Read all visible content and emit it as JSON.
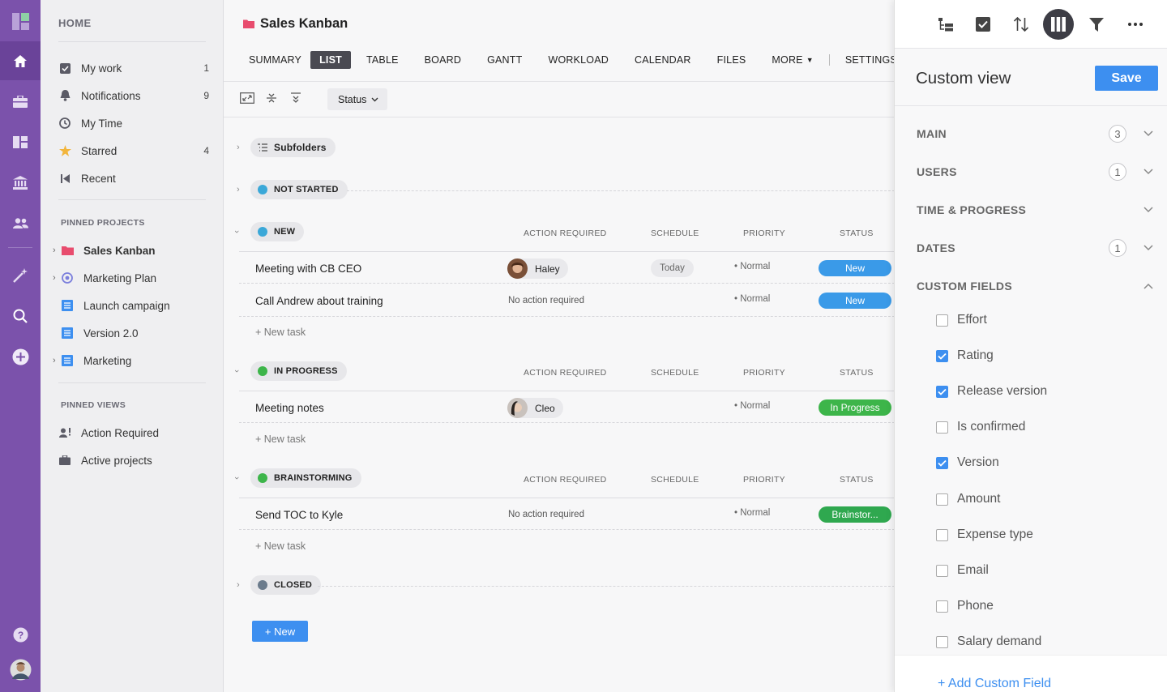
{
  "colors": {
    "accent": "#7b52ab",
    "primary": "#3d8ff0",
    "status_new": "#3a9ae8",
    "status_progress": "#3db54a",
    "status_brainstorm": "#2fa84f"
  },
  "rail": {
    "icons": [
      "app-logo-icon",
      "home-icon",
      "briefcase-icon",
      "dashboard-icon",
      "bank-icon",
      "people-icon",
      "magic-wand-icon",
      "search-icon",
      "add-icon",
      "help-icon",
      "user-avatar"
    ]
  },
  "sidebar": {
    "home_label": "HOME",
    "items": [
      {
        "label": "My work",
        "count": "1",
        "icon": "checkbox-icon"
      },
      {
        "label": "Notifications",
        "count": "9",
        "icon": "bell-icon"
      },
      {
        "label": "My Time",
        "count": "",
        "icon": "clock-icon"
      },
      {
        "label": "Starred",
        "count": "4",
        "icon": "star-icon"
      },
      {
        "label": "Recent",
        "count": "",
        "icon": "recent-icon"
      }
    ],
    "pinned_projects_label": "PINNED PROJECTS",
    "projects": [
      {
        "label": "Sales Kanban",
        "icon": "folder-icon"
      },
      {
        "label": "Marketing Plan",
        "icon": "target-icon"
      },
      {
        "label": "Launch campaign",
        "icon": "list-icon"
      },
      {
        "label": "Version 2.0",
        "icon": "list-icon"
      },
      {
        "label": "Marketing",
        "icon": "list-icon"
      }
    ],
    "pinned_views_label": "PINNED VIEWS",
    "views": [
      {
        "label": "Action Required",
        "icon": "person-alert-icon"
      },
      {
        "label": "Active projects",
        "icon": "briefcase-icon"
      }
    ]
  },
  "main": {
    "title": "Sales Kanban",
    "tabs": [
      "SUMMARY",
      "LIST",
      "TABLE",
      "BOARD",
      "GANTT",
      "WORKLOAD",
      "CALENDAR",
      "FILES",
      "MORE",
      "SETTINGS"
    ],
    "active_tab": "LIST",
    "status_filter": "Status",
    "col_action": "ACTION REQUIRED",
    "col_schedule": "SCHEDULE",
    "col_priority": "PRIORITY",
    "col_status": "STATUS",
    "subfolders": "Subfolders",
    "groups": {
      "not_started": "NOT STARTED",
      "new": "NEW",
      "in_progress": "IN PROGRESS",
      "brainstorming": "BRAINSTORMING",
      "closed": "CLOSED"
    },
    "tasks": {
      "t1": {
        "name": "Meeting with CB CEO",
        "user": "Haley",
        "schedule": "Today",
        "priority": "• Normal",
        "status": "New"
      },
      "t2": {
        "name": "Call Andrew about training",
        "action": "No action required",
        "priority": "• Normal",
        "status": "New"
      },
      "t3": {
        "name": "Meeting notes",
        "user": "Cleo",
        "priority": "• Normal",
        "status": "In Progress"
      },
      "t4": {
        "name": "Send TOC to Kyle",
        "action": "No action required",
        "priority": "• Normal",
        "status": "Brainstor..."
      }
    },
    "new_task": "+ New task",
    "new_button": "+  New"
  },
  "panel": {
    "title": "Custom view",
    "save": "Save",
    "sections": {
      "main": "MAIN",
      "users": "USERS",
      "time": "TIME & PROGRESS",
      "dates": "DATES",
      "custom": "CUSTOM FIELDS"
    },
    "counts": {
      "main": "3",
      "users": "1",
      "dates": "1"
    },
    "fields": [
      {
        "label": "Effort",
        "checked": false
      },
      {
        "label": "Rating",
        "checked": true
      },
      {
        "label": "Release version",
        "checked": true
      },
      {
        "label": "Is confirmed",
        "checked": false
      },
      {
        "label": "Version",
        "checked": true
      },
      {
        "label": "Amount",
        "checked": false
      },
      {
        "label": "Expense type",
        "checked": false
      },
      {
        "label": "Email",
        "checked": false
      },
      {
        "label": "Phone",
        "checked": false
      },
      {
        "label": "Salary demand",
        "checked": false
      }
    ],
    "add_field": "+ Add Custom Field"
  }
}
